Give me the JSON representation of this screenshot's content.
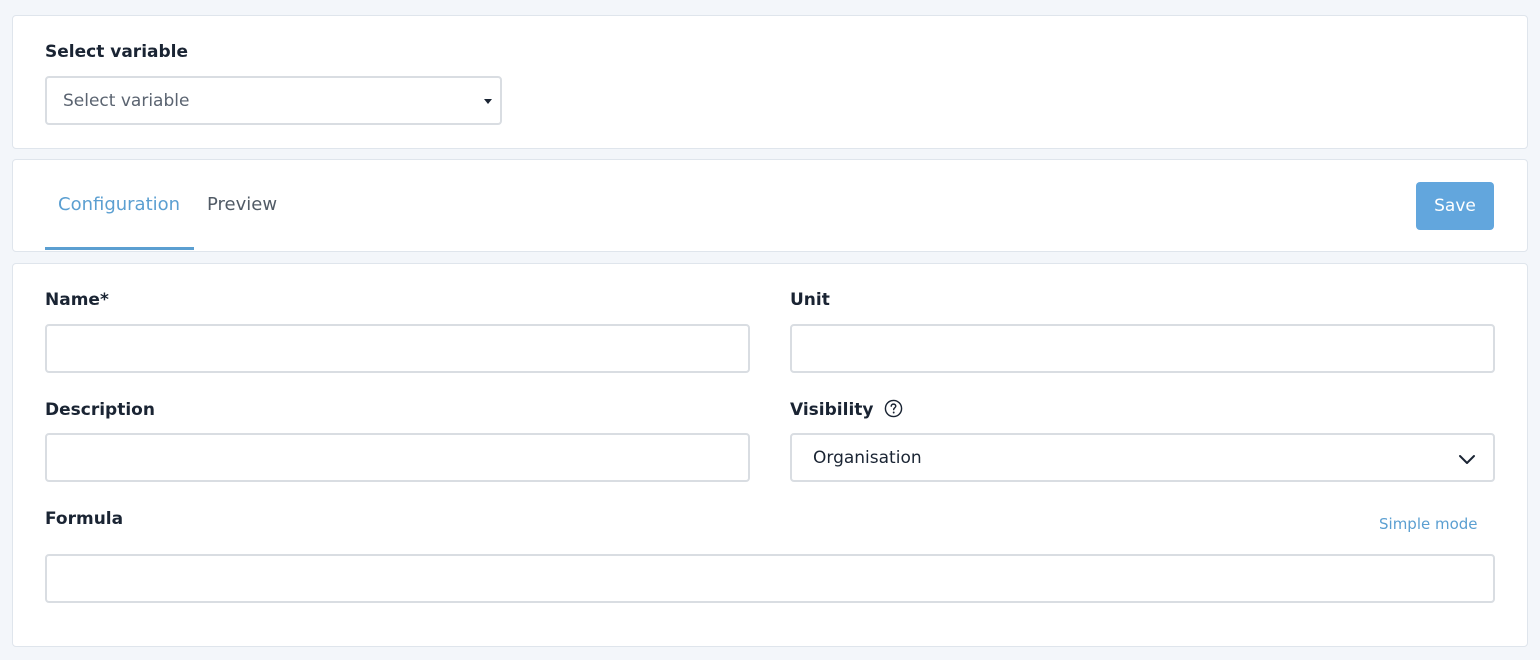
{
  "variable_picker": {
    "label": "Select variable",
    "placeholder": "Select variable"
  },
  "tabs": [
    {
      "label": "Configuration",
      "active": true
    },
    {
      "label": "Preview",
      "active": false
    }
  ],
  "toolbar": {
    "save_label": "Save"
  },
  "form": {
    "name": {
      "label": "Name*",
      "value": ""
    },
    "unit": {
      "label": "Unit",
      "value": ""
    },
    "description": {
      "label": "Description",
      "value": ""
    },
    "visibility": {
      "label": "Visibility",
      "selected": "Organisation"
    },
    "formula": {
      "label": "Formula",
      "value": "",
      "mode_link": "Simple mode"
    }
  },
  "colors": {
    "accent": "#5b9fd1",
    "button": "#62a6dd",
    "text": "#1a2433",
    "border": "#d9dde2"
  },
  "icons": {
    "select_caret": "caret-down-icon",
    "visibility_help": "question-circle-icon",
    "visibility_chevron": "chevron-down-icon"
  }
}
